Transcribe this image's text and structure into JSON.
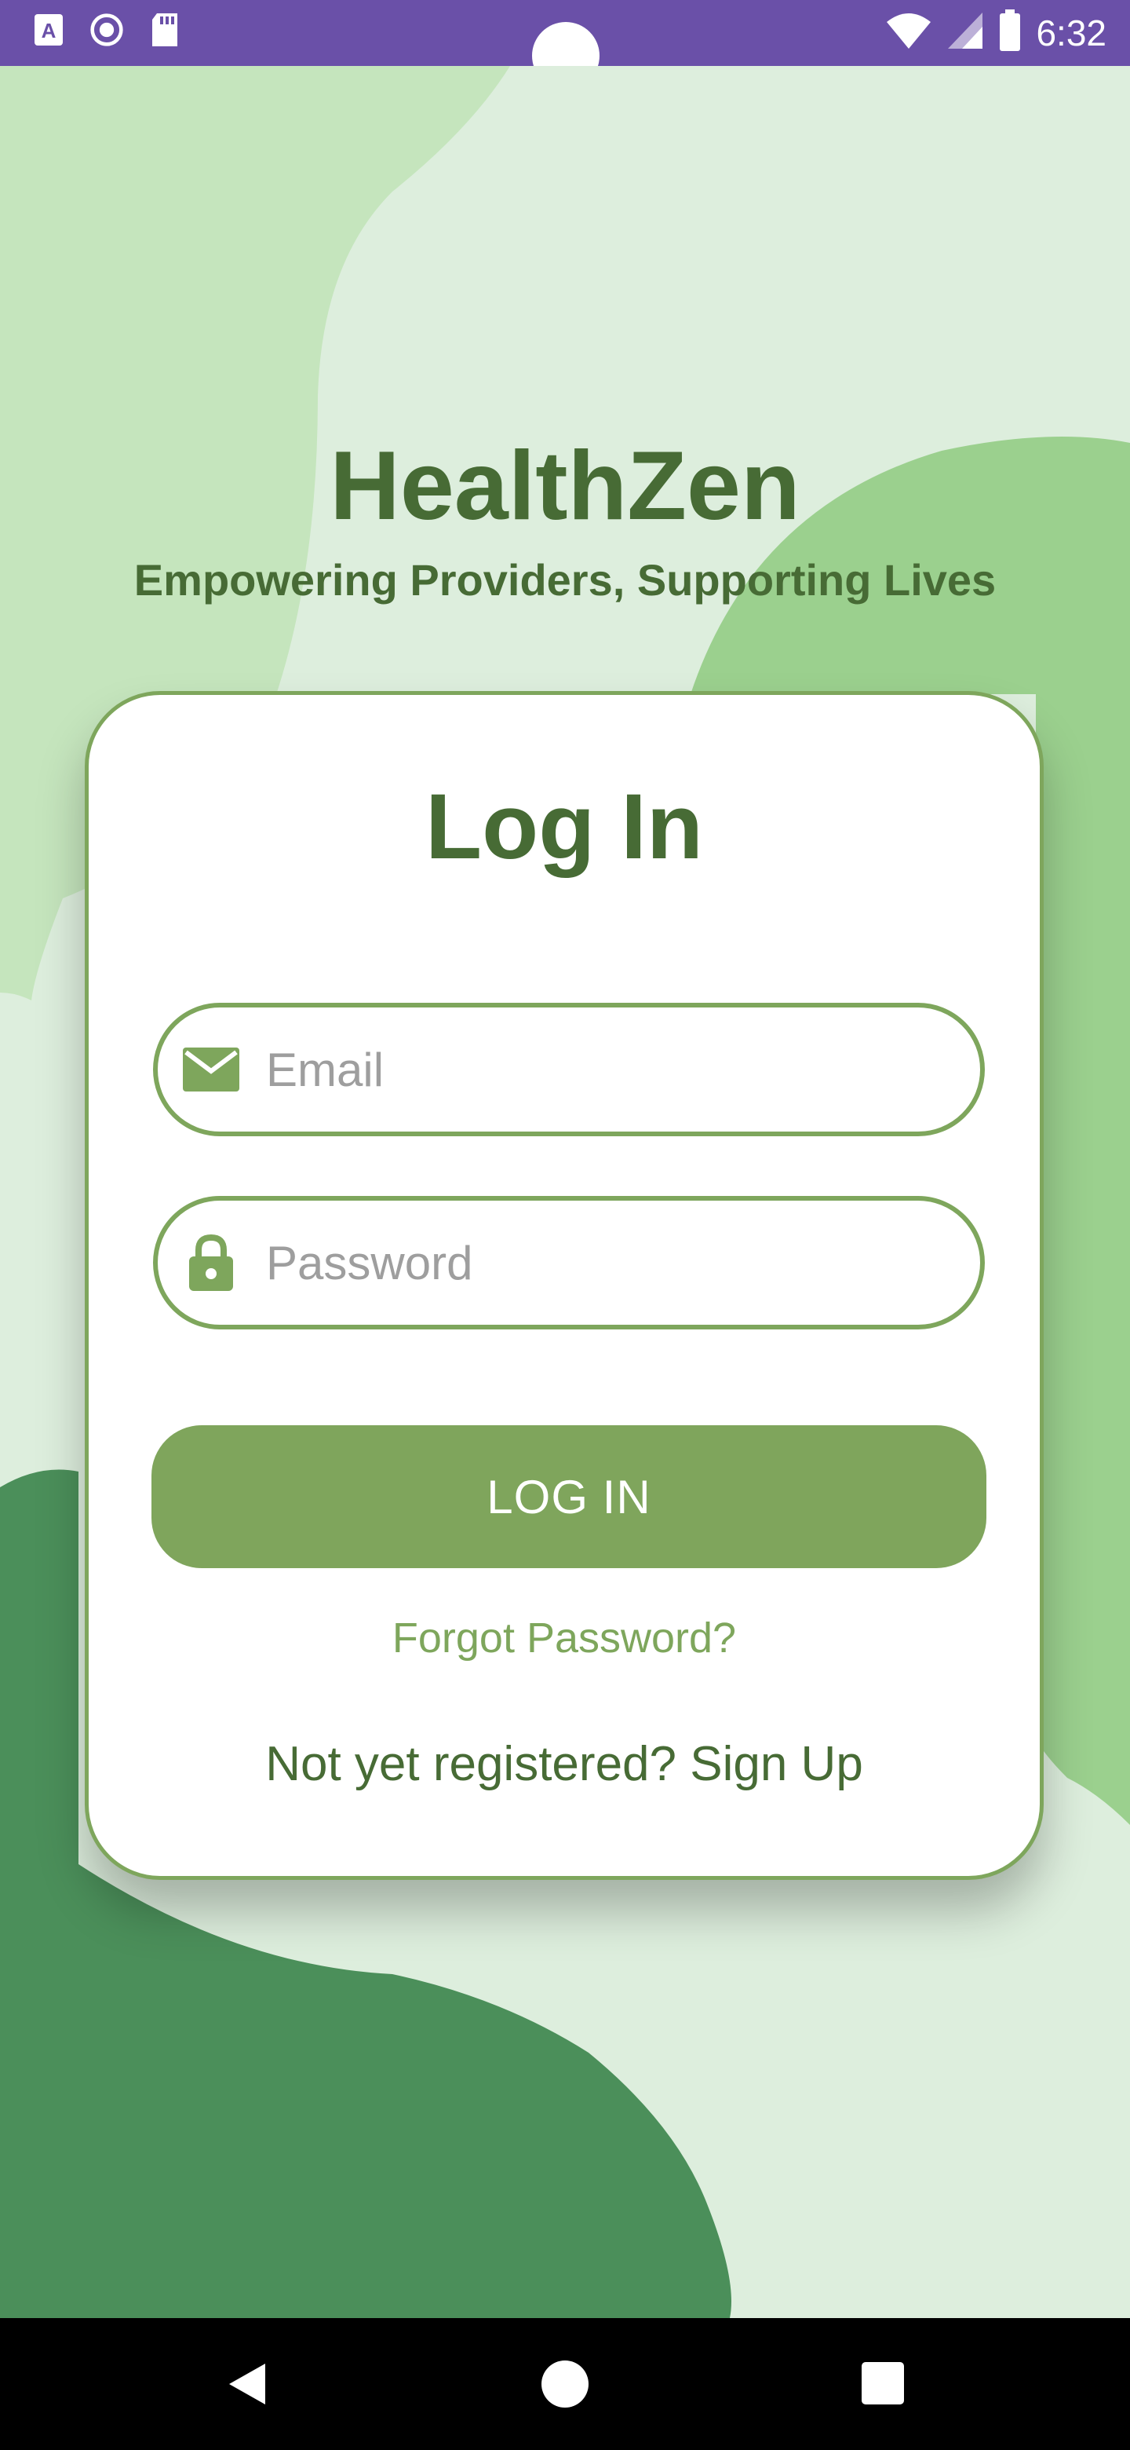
{
  "status_bar": {
    "time": "6:32",
    "icons": [
      "a-keyboard-icon",
      "record-icon",
      "sd-card-icon",
      "wifi-icon",
      "signal-icon",
      "battery-icon"
    ]
  },
  "app": {
    "title": "HealthZen",
    "tagline": "Empowering Providers, Supporting Lives"
  },
  "login_card": {
    "heading": "Log In",
    "email_placeholder": "Email",
    "password_placeholder": "Password",
    "login_button": "LOG IN",
    "forgot_password": "Forgot Password?",
    "signup_prompt": "Not yet registered? Sign Up"
  },
  "nav_bar": {
    "icons": [
      "back-icon",
      "home-icon",
      "recents-icon"
    ]
  },
  "colors": {
    "status_bar": "#6a50a8",
    "primary_green": "#7fa55c",
    "dark_green": "#476b35",
    "background_light": "#ddeedd",
    "blob_light": "#c5e5bd",
    "blob_mid": "#9bd08e",
    "blob_dark": "#4b8f5a"
  }
}
